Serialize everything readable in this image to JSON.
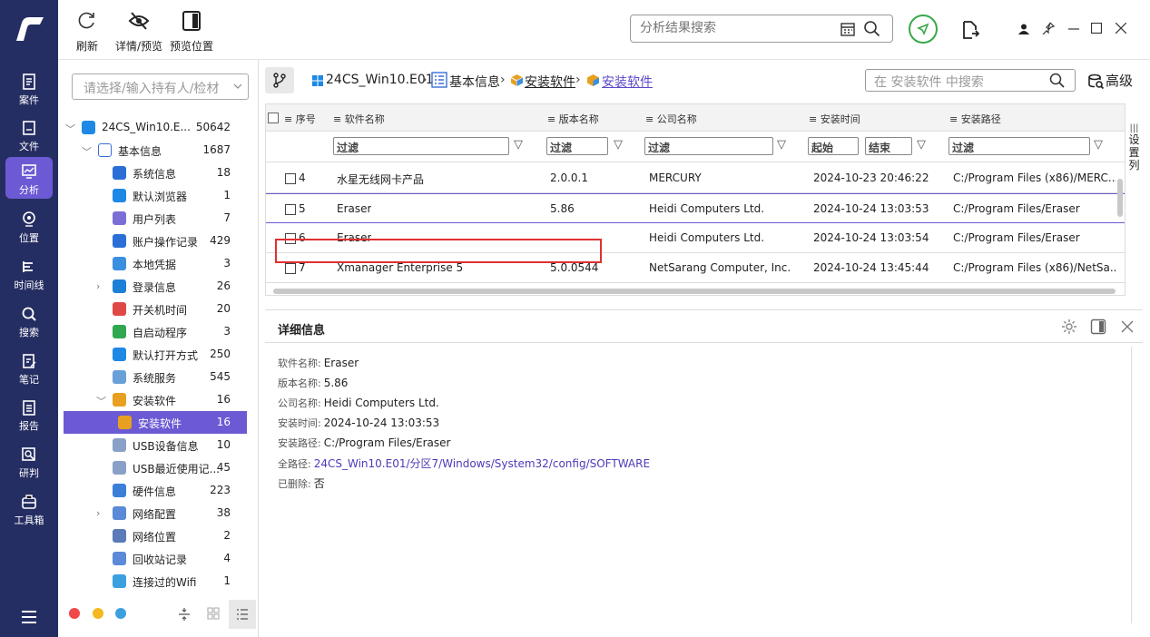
{
  "toolbar": {
    "refresh": "刷新",
    "detail_preview": "详情/预览",
    "preview_pos": "预览位置",
    "search_placeholder": "分析结果搜索"
  },
  "nav": [
    {
      "label": "案件",
      "icon": "case-icon"
    },
    {
      "label": "文件",
      "icon": "file-icon"
    },
    {
      "label": "分析",
      "icon": "analysis-icon"
    },
    {
      "label": "位置",
      "icon": "location-icon"
    },
    {
      "label": "时间线",
      "icon": "timeline-icon"
    },
    {
      "label": "搜索",
      "icon": "search-icon"
    },
    {
      "label": "笔记",
      "icon": "note-icon"
    },
    {
      "label": "报告",
      "icon": "report-icon"
    },
    {
      "label": "研判",
      "icon": "judge-icon"
    },
    {
      "label": "工具箱",
      "icon": "toolbox-icon"
    }
  ],
  "sidebar": {
    "holder_placeholder": "请选择/输入持有人/检材",
    "tree": [
      {
        "label": "24CS_Win10.E...",
        "count": "50642",
        "color": "#1e88e5"
      },
      {
        "label": "基本信息",
        "count": "1687",
        "color": "#3b6fd8"
      },
      {
        "label": "系统信息",
        "count": "18",
        "color": "#2b6fd6"
      },
      {
        "label": "默认浏览器",
        "count": "1",
        "color": "#1e88e5"
      },
      {
        "label": "用户列表",
        "count": "7",
        "color": "#7b6fd6"
      },
      {
        "label": "账户操作记录",
        "count": "429",
        "color": "#2b6fd6"
      },
      {
        "label": "本地凭据",
        "count": "3",
        "color": "#3b8fe0"
      },
      {
        "label": "登录信息",
        "count": "26",
        "color": "#1e7fd6"
      },
      {
        "label": "开关机时间",
        "count": "20",
        "color": "#e04848"
      },
      {
        "label": "自启动程序",
        "count": "3",
        "color": "#2fa84f"
      },
      {
        "label": "默认打开方式",
        "count": "250",
        "color": "#1e88e5"
      },
      {
        "label": "系统服务",
        "count": "545",
        "color": "#6aa0d8"
      },
      {
        "label": "安装软件",
        "count": "16",
        "color": "#e8a020"
      },
      {
        "label": "安装软件",
        "count": "16",
        "color": "#e8a020"
      },
      {
        "label": "USB设备信息",
        "count": "10",
        "color": "#8aa0c8"
      },
      {
        "label": "USB最近使用记...",
        "count": "45",
        "color": "#8aa0c8"
      },
      {
        "label": "硬件信息",
        "count": "223",
        "color": "#3b7fd8"
      },
      {
        "label": "网络配置",
        "count": "38",
        "color": "#5a8ad8"
      },
      {
        "label": "网络位置",
        "count": "2",
        "color": "#5a7ab8"
      },
      {
        "label": "回收站记录",
        "count": "4",
        "color": "#5a8ad8"
      },
      {
        "label": "连接过的Wifi",
        "count": "1",
        "color": "#3b9fe0"
      }
    ]
  },
  "breadcrumb": {
    "b1": "24CS_Win10.E01",
    "b2": "基本信息",
    "b3": "安装软件",
    "b4": "安装软件",
    "search_placeholder": "在 安装软件 中搜索",
    "advanced": "高级"
  },
  "table": {
    "headers": {
      "seq": "序号",
      "name": "软件名称",
      "version": "版本名称",
      "company": "公司名称",
      "time": "安装时间",
      "path": "安装路径"
    },
    "filter": "过滤",
    "start": "起始",
    "end": "结束",
    "setcol": "设置列",
    "rows": [
      {
        "seq": "4",
        "name": "水星无线网卡产品",
        "version": "2.0.0.1",
        "company": "MERCURY",
        "time": "2024-10-23 20:46:22",
        "path": "C:/Program Files (x86)/MERC..."
      },
      {
        "seq": "5",
        "name": "Eraser",
        "version": "5.86",
        "company": "Heidi Computers Ltd.",
        "time": "2024-10-24 13:03:53",
        "path": "C:/Program Files/Eraser"
      },
      {
        "seq": "6",
        "name": "Eraser",
        "version": "",
        "company": "Heidi Computers Ltd.",
        "time": "2024-10-24 13:03:54",
        "path": "C:/Program Files/Eraser"
      },
      {
        "seq": "7",
        "name": "Xmanager Enterprise 5",
        "version": "5.0.0544",
        "company": "NetSarang Computer, Inc.",
        "time": "2024-10-24 13:45:44",
        "path": "C:/Program Files (x86)/NetSa..."
      }
    ]
  },
  "detail": {
    "title": "详细信息",
    "fields": [
      {
        "k": "软件名称:",
        "v": "Eraser"
      },
      {
        "k": "版本名称:",
        "v": "5.86"
      },
      {
        "k": "公司名称:",
        "v": "Heidi Computers Ltd."
      },
      {
        "k": "安装时间:",
        "v": "2024-10-24 13:03:53"
      },
      {
        "k": "安装路径:",
        "v": "C:/Program Files/Eraser"
      },
      {
        "k": "全路径:",
        "v": "24CS_Win10.E01/分区7/Windows/System32/config/SOFTWARE"
      },
      {
        "k": "已删除:",
        "v": "否"
      }
    ]
  }
}
